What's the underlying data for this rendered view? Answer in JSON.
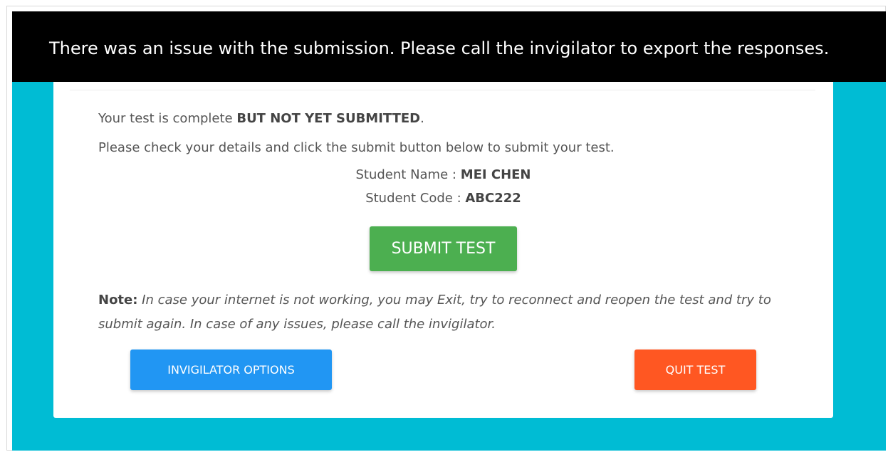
{
  "banner": {
    "message": "There was an issue with the submission. Please call the invigilator to export the responses."
  },
  "status": {
    "prefix": "Your test is complete ",
    "emphasis": "BUT NOT YET SUBMITTED",
    "suffix": "."
  },
  "instructions": "Please check your details and click the submit button below to submit your test.",
  "student": {
    "name_label": "Student Name : ",
    "name_value": "MEI CHEN",
    "code_label": "Student Code : ",
    "code_value": "ABC222"
  },
  "buttons": {
    "submit_label": "SUBMIT TEST",
    "invigilator_label": "INVIGILATOR OPTIONS",
    "quit_label": "QUIT TEST"
  },
  "note": {
    "label": "Note:",
    "text": " In case your internet is not working, you may Exit, try to reconnect and reopen the test and try to submit again. In case of any issues, please call the invigilator."
  },
  "colors": {
    "banner_bg": "#000000",
    "backdrop": "#00bcd4",
    "submit": "#4caf50",
    "invigilator": "#2196f3",
    "quit": "#ff5722"
  }
}
